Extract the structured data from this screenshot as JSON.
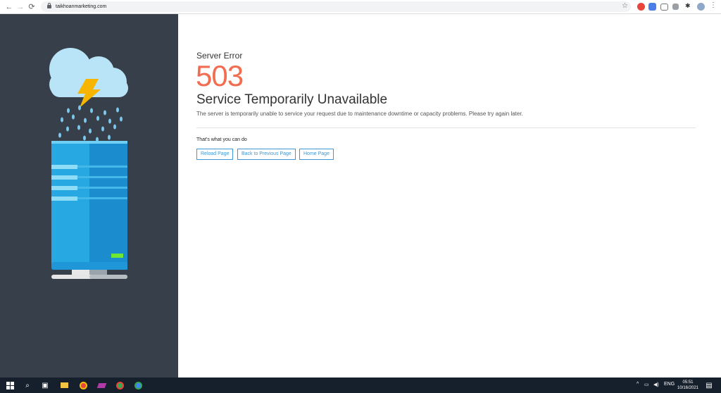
{
  "browser": {
    "url": "taikhoanmarketing.com"
  },
  "error": {
    "eyebrow": "Server Error",
    "code": "503",
    "title": "Service Temporarily Unavailable",
    "description": "The server is temporarily unable to service your request due to maintenance downtime or capacity problems. Please try again later.",
    "actions_heading": "That's what you can do",
    "buttons": [
      {
        "label": "Reload Page"
      },
      {
        "label": "Back to Previous Page"
      },
      {
        "label": "Home Page"
      }
    ]
  },
  "taskbar": {
    "language": "ENG",
    "time": "05:51",
    "date": "10/16/2021"
  },
  "colors": {
    "sidebar": "#37404a",
    "code": "#f26c4f",
    "button_border": "#3d98d5"
  }
}
